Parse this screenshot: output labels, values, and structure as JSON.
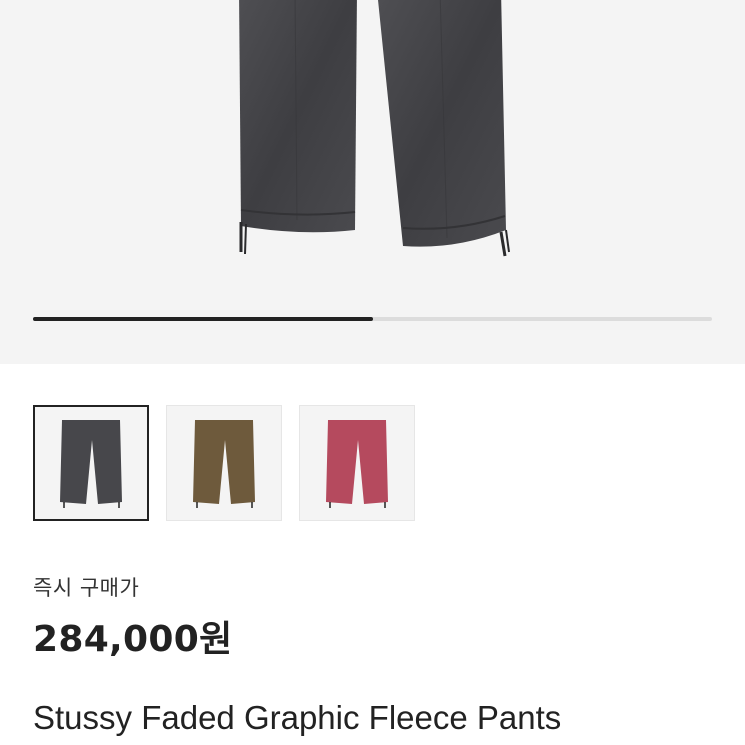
{
  "product": {
    "images": [
      {
        "color_name": "charcoal",
        "color": "#47474b"
      },
      {
        "color_name": "brown",
        "color": "#6e5a3c"
      },
      {
        "color_name": "pink",
        "color": "#b54a5e"
      }
    ],
    "carousel_progress": 0.5,
    "selected_index": 0,
    "price_label": "즉시 구매가",
    "price": "284,000원",
    "title": "Stussy Faded Graphic Fleece Pants"
  },
  "colors": {
    "accent": "#222222",
    "track": "#dcdcdc",
    "image_bg": "#f4f4f4"
  }
}
